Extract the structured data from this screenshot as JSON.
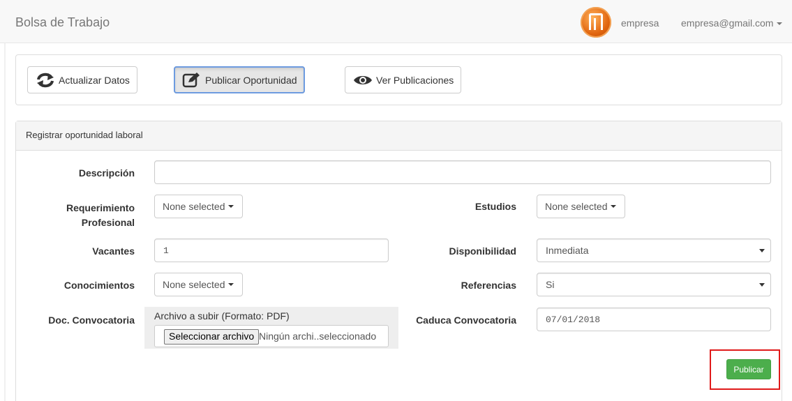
{
  "navbar": {
    "brand": "Bolsa de Trabajo",
    "user_name": "empresa",
    "user_email": "empresa@gmail.com",
    "avatar_icon": "brand-logo-icon"
  },
  "toolbar": {
    "buttons": [
      {
        "label": "Actualizar Datos",
        "icon": "refresh-icon",
        "active": false
      },
      {
        "label": "Publicar Oportunidad",
        "icon": "edit-icon",
        "active": true
      },
      {
        "label": "Ver Publicaciones",
        "icon": "eye-icon",
        "active": false
      }
    ]
  },
  "form": {
    "heading": "Registrar oportunidad laboral",
    "descripcion": {
      "label": "Descripción",
      "value": ""
    },
    "requerimiento": {
      "label_line1": "Requerimiento",
      "label_line2": "Profesional",
      "value": "None selected"
    },
    "estudios": {
      "label": "Estudios",
      "value": "None selected"
    },
    "vacantes": {
      "label": "Vacantes",
      "value": "1"
    },
    "disponibilidad": {
      "label": "Disponibilidad",
      "value": "Inmediata"
    },
    "conocimientos": {
      "label": "Conocimientos",
      "value": "None selected"
    },
    "referencias": {
      "label": "Referencias",
      "value": "Si"
    },
    "doc_convocatoria": {
      "label": "Doc. Convocatoria",
      "caption": "Archivo a subir (Formato: PDF)",
      "button_label": "Seleccionar archivo",
      "status": "Ningún archi..seleccionado"
    },
    "caduca": {
      "label": "Caduca Convocatoria",
      "value": "07/01/2018"
    },
    "submit_label": "Publicar"
  },
  "colors": {
    "accent_green": "#4cae4c",
    "highlight_red": "#e01a1a",
    "active_outline": "#6d9be0"
  }
}
